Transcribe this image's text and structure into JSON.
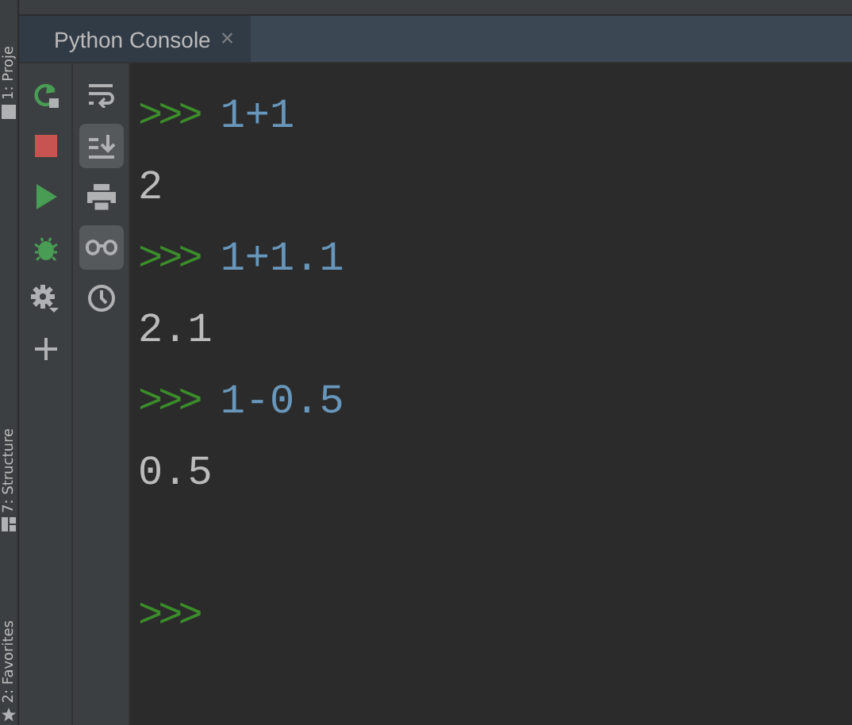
{
  "side_tabs": [
    {
      "label": "1: Proje",
      "kind": "project"
    },
    {
      "label": "7: Structure",
      "kind": "structure"
    },
    {
      "label": "2: Favorites",
      "kind": "favorites"
    }
  ],
  "tab": {
    "label": "Python Console",
    "close": "×"
  },
  "toolbar": [
    {
      "kind": "rerun"
    },
    {
      "kind": "stop"
    },
    {
      "kind": "run"
    },
    {
      "kind": "debug"
    },
    {
      "kind": "settings"
    },
    {
      "kind": "add"
    }
  ],
  "toolbar_2": [
    {
      "kind": "wrap",
      "on": false
    },
    {
      "kind": "scroll-end",
      "on": true
    },
    {
      "kind": "print",
      "on": false
    },
    {
      "kind": "variables",
      "on": true
    },
    {
      "kind": "history",
      "on": false
    }
  ],
  "console": [
    {
      "kind": "input",
      "prompt": ">>>",
      "text": "1+1"
    },
    {
      "kind": "output",
      "text": "2"
    },
    {
      "kind": "input",
      "prompt": ">>>",
      "text": "1+1.1"
    },
    {
      "kind": "output",
      "text": "2.1"
    },
    {
      "kind": "input",
      "prompt": ">>>",
      "text": "1-0.5"
    },
    {
      "kind": "output",
      "text": "0.5"
    },
    {
      "kind": "blank"
    },
    {
      "kind": "prompt",
      "prompt": ">>>"
    }
  ]
}
